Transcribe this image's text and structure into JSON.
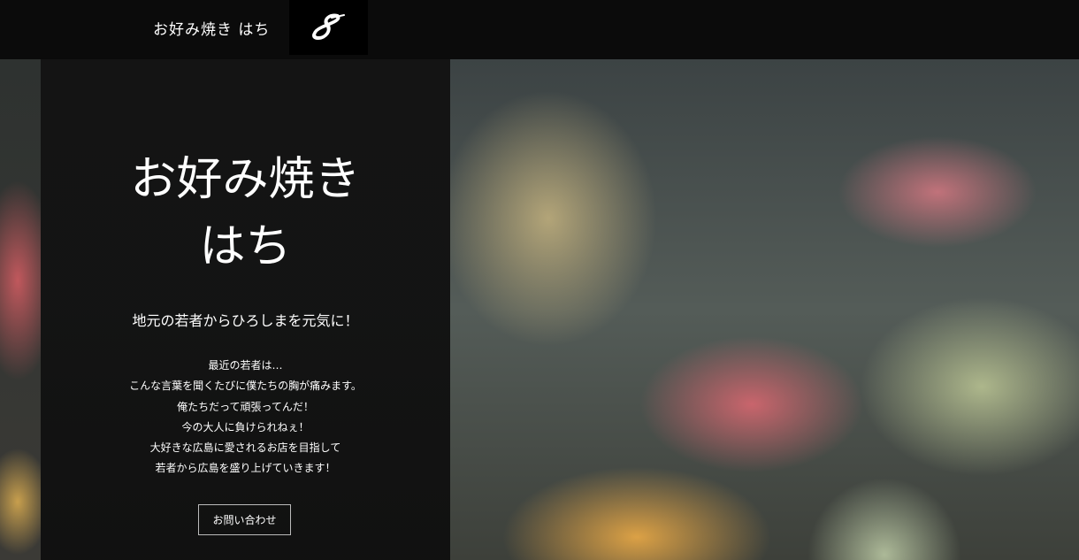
{
  "header": {
    "brand": "お好み焼き はち",
    "logo_icon": "figure-eight-logo"
  },
  "hero": {
    "title_lines": [
      "お好み焼き",
      "はち"
    ],
    "tagline": "地元の若者からひろしまを元気に！",
    "body_lines": [
      "最近の若者は…",
      "こんな言葉を聞くたびに僕たちの胸が痛みます。",
      "俺たちだって頑張ってんだ！",
      "今の大人に負けられねぇ！",
      "大好きな広島に愛されるお店を目指して",
      "若者から広島を盛り上げていきます！"
    ],
    "cta_label": "お問い合わせ",
    "background_image": "okonomiyaki-photo"
  },
  "colors": {
    "header_bg": "#0b0b0b",
    "panel_bg": "#121212",
    "text": "#ffffff",
    "button_border": "#bbbbbb"
  }
}
